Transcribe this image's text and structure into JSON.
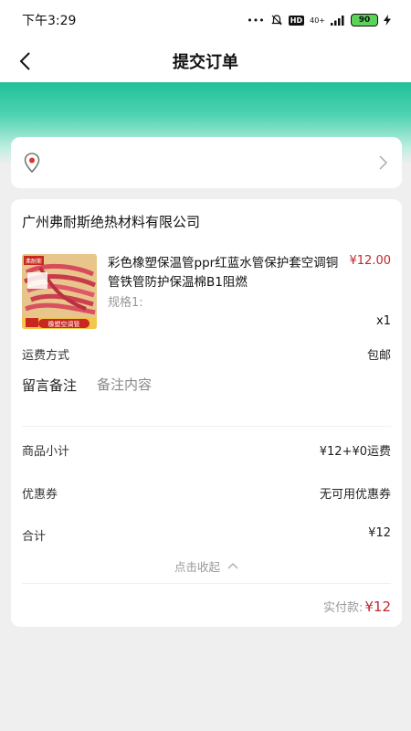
{
  "status_bar": {
    "time": "下午3:29",
    "signal_text": "40+",
    "battery": "90"
  },
  "nav": {
    "title": "提交订单"
  },
  "address": {
    "text": ""
  },
  "order": {
    "shop_name": "广州弗耐斯绝热材料有限公司",
    "product": {
      "title": "彩色橡塑保温管ppr红蓝水管保护套空调铜管铁管防护保温棉B1阻燃",
      "price": "¥12.00",
      "spec": "规格1:",
      "quantity": "x1",
      "image_brand_tag": "弗耐斯",
      "image_caption": "橡塑空调管"
    },
    "shipping": {
      "label": "运费方式",
      "value": "包邮"
    },
    "remark": {
      "label": "留言备注",
      "placeholder": "备注内容",
      "value": ""
    },
    "subtotal": {
      "label": "商品小计",
      "value": "¥12+¥0运费"
    },
    "coupon": {
      "label": "优惠券",
      "value": "无可用优惠券"
    },
    "total": {
      "label": "合计",
      "value": "¥12"
    },
    "collapse_label": "点击收起",
    "paid": {
      "label": "实付款:",
      "amount": "¥12"
    }
  },
  "colors": {
    "accent_green": "#1fc09a",
    "price_red": "#c1272d"
  },
  "icons": {
    "back": "chevron-left-icon",
    "location": "location-pin-icon",
    "address_arrow": "chevron-right-icon",
    "collapse": "chevron-up-icon"
  }
}
